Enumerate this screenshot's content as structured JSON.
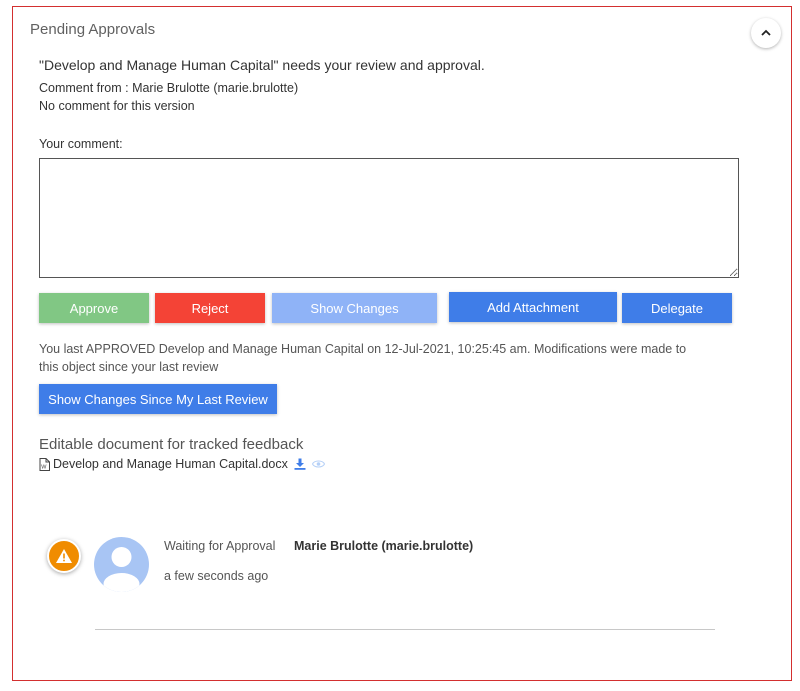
{
  "panel": {
    "title": "Pending Approvals"
  },
  "review": {
    "message": "\"Develop and Manage Human Capital\" needs your review and approval.",
    "comment_from": "Comment from : Marie Brulotte (marie.brulotte)",
    "no_comment": "No comment for this version",
    "your_comment_label": "Your comment:",
    "comment_value": ""
  },
  "actions": {
    "approve": "Approve",
    "reject": "Reject",
    "show_changes": "Show Changes",
    "add_attachment": "Add Attachment",
    "delegate": "Delegate"
  },
  "history": {
    "last_approved": "You last APPROVED Develop and Manage Human Capital on 12-Jul-2021, 10:25:45 am. Modifications were made to this object since your last review",
    "show_since_label": "Show Changes Since My Last Review"
  },
  "document": {
    "section_title": "Editable document for tracked feedback",
    "file_name": "Develop and Manage Human Capital.docx"
  },
  "workflow": {
    "status": "Waiting for Approval",
    "approver": "Marie Brulotte (marie.brulotte)",
    "time": "a few seconds ago"
  },
  "colors": {
    "approve": "#81c784",
    "reject": "#f44336",
    "primary": "#3f7de8",
    "primary_disabled": "#8fb3f7",
    "warning": "#f08c00",
    "avatar": "#a8c5f4",
    "border": "#d32f2f"
  },
  "icons": {
    "collapse": "chevron-up-icon",
    "document": "word-document-icon",
    "download": "download-icon",
    "preview": "eye-icon",
    "warning": "warning-triangle-icon",
    "avatar": "user-avatar-icon"
  }
}
